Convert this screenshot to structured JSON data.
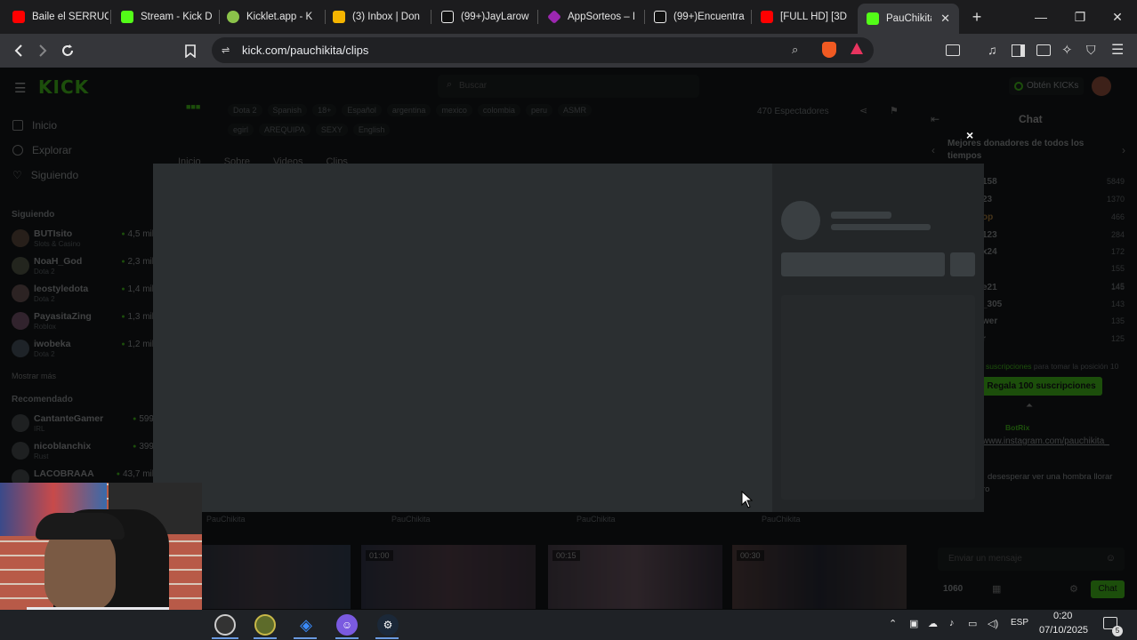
{
  "tabs": [
    {
      "title": "Baile el SERRUC",
      "favicon_color": "#ff0000"
    },
    {
      "title": "Stream - Kick D",
      "favicon_color": "#53fc18"
    },
    {
      "title": "Kicklet.app - K",
      "favicon_color": "#8bc34a"
    },
    {
      "title": "(3) Inbox | Don",
      "favicon_color": "#f4b400"
    },
    {
      "title": "(99+)JayLarow",
      "favicon_color": "#111111"
    },
    {
      "title": "AppSorteos – I",
      "favicon_color": "#9c27b0"
    },
    {
      "title": "(99+)Encuentra",
      "favicon_color": "#111111"
    },
    {
      "title": "[FULL HD] [3D",
      "favicon_color": "#ff0000"
    },
    {
      "title": "PauChikita",
      "favicon_color": "#53fc18"
    }
  ],
  "new_tab_label": "+",
  "url": "kick.com/pauchikita/clips",
  "site": {
    "logo": "KICK",
    "search_placeholder": "Buscar",
    "get_kicks": "Obtén KICKs",
    "nav": [
      "Inicio",
      "Explorar",
      "Siguiendo"
    ],
    "following_title": "Siguiendo",
    "following": [
      {
        "name": "BUTIsito",
        "game": "Slots & Casino",
        "viewers": "4,5 mil"
      },
      {
        "name": "NoaH_God",
        "game": "Dota 2",
        "viewers": "2,3 mil"
      },
      {
        "name": "leostyledota",
        "game": "Dota 2",
        "viewers": "1,4 mil"
      },
      {
        "name": "PayasitaZing",
        "game": "Roblox",
        "viewers": "1,3 mil"
      },
      {
        "name": "iwobeka",
        "game": "Dota 2",
        "viewers": "1,2 mil"
      }
    ],
    "show_more": "Mostrar más",
    "recommended_title": "Recomendado",
    "recommended": [
      {
        "name": "CantanteGamer",
        "game": "IRL",
        "viewers": "599"
      },
      {
        "name": "nicoblanchix",
        "game": "Rust",
        "viewers": "399"
      },
      {
        "name": "LACOBRAAA",
        "game": "",
        "viewers": "43,7 mil"
      }
    ],
    "channel_game": "Dota 2",
    "tags_row1": [
      "Spanish",
      "18+",
      "Español",
      "argentina",
      "mexico",
      "colombia",
      "peru",
      "ASMR"
    ],
    "tags_row2": [
      "egirl",
      "AREQUIPA",
      "SEXY",
      "English"
    ],
    "viewers": "470 Espectadores",
    "profile_tabs": [
      "Inicio",
      "Sobre",
      "Videos",
      "Clips"
    ],
    "chat_title": "Chat",
    "donors_title": "Mejores donadores de todos los tiempos",
    "donors": [
      {
        "name": "158",
        "amount": "5849"
      },
      {
        "name": "23",
        "amount": "1370"
      },
      {
        "name": "op",
        "amount": "466"
      },
      {
        "name": "123",
        "amount": "284"
      },
      {
        "name": "x24",
        "amount": "172"
      },
      {
        "name": "",
        "amount": "155"
      },
      {
        "name": "",
        "amount": "145"
      },
      {
        "name": "e21",
        "amount": "145"
      },
      {
        "name": "_305",
        "amount": "143"
      },
      {
        "name": "wer",
        "amount": "135"
      },
      {
        "name": "r",
        "amount": "125"
      }
    ],
    "subs_text": "suscripciones",
    "subs_suffix": "para tomar la posición 10",
    "gift_button": "Regala 100 suscripciones",
    "pinned_user": "BotRix",
    "pinned_link": "www.instagram.com/pauchikita_",
    "chat_msg": "desesperar ver una hombra llorar",
    "chat_msg2": "ro",
    "chat_placeholder": "Enviar un mensaje",
    "kicks_balance": "1060",
    "chat_button": "Chat",
    "clip_authors": [
      "PauChikita",
      "PauChikita",
      "PauChikita",
      "PauChikita"
    ],
    "clip_durations": [
      "",
      "01:00",
      "00:15",
      "00:30"
    ]
  },
  "modal": {
    "close": "×"
  },
  "taskbar": {
    "lang": "ESP",
    "time": "0:20",
    "date": "07/10/2025",
    "notif_count": "5"
  }
}
